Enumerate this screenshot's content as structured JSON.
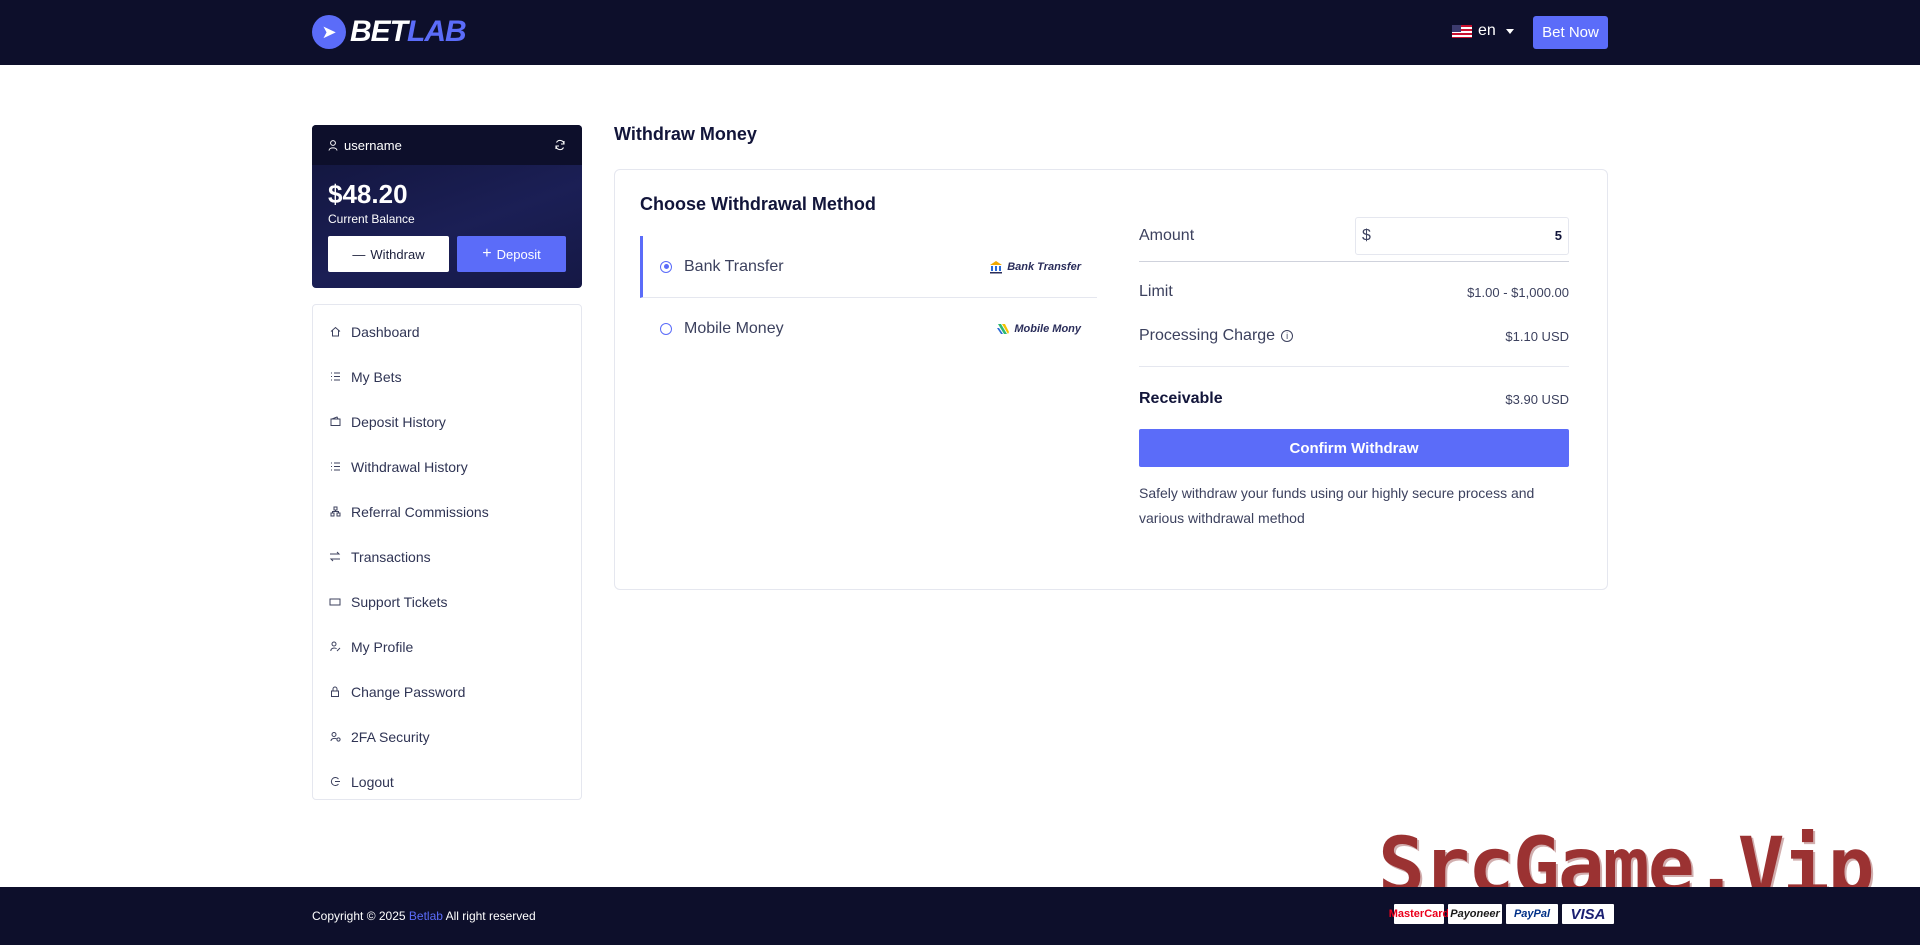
{
  "header": {
    "logo_bet": "BET",
    "logo_lab": "LAB",
    "language": "en",
    "bet_now": "Bet Now"
  },
  "balance": {
    "username": "username",
    "amount": "$48.20",
    "label": "Current Balance",
    "withdraw": "Withdraw",
    "deposit": "Deposit"
  },
  "menu": [
    {
      "label": "Dashboard",
      "icon": "home-icon"
    },
    {
      "label": "My Bets",
      "icon": "list-icon"
    },
    {
      "label": "Deposit History",
      "icon": "wallet-icon"
    },
    {
      "label": "Withdrawal History",
      "icon": "list-icon"
    },
    {
      "label": "Referral Commissions",
      "icon": "network-icon"
    },
    {
      "label": "Transactions",
      "icon": "exchange-icon"
    },
    {
      "label": "Support Tickets",
      "icon": "ticket-icon"
    },
    {
      "label": "My Profile",
      "icon": "user-edit-icon"
    },
    {
      "label": "Change Password",
      "icon": "lock-icon"
    },
    {
      "label": "2FA Security",
      "icon": "shield-user-icon"
    },
    {
      "label": "Logout",
      "icon": "logout-icon"
    }
  ],
  "main": {
    "title": "Withdraw Money",
    "choose_title": "Choose Withdrawal Method",
    "methods": [
      {
        "label": "Bank Transfer",
        "logo": "Bank Transfer",
        "selected": true
      },
      {
        "label": "Mobile Money",
        "logo": "Mobile Mony",
        "selected": false
      }
    ],
    "amount_label": "Amount",
    "currency_symbol": "$",
    "amount_value": "5",
    "limit_label": "Limit",
    "limit_value": "$1.00 - $1,000.00",
    "charge_label": "Processing Charge",
    "charge_value": "$1.10 USD",
    "receivable_label": "Receivable",
    "receivable_value": "$3.90 USD",
    "confirm": "Confirm Withdraw",
    "note": "Safely withdraw your funds using our highly secure process and various withdrawal method"
  },
  "footer": {
    "copyright_prefix": "Copyright © 2025",
    "brand": "Betlab",
    "copyright_suffix": "All right reserved",
    "payments": [
      "MasterCard",
      "Payoneer",
      "PayPal",
      "VISA"
    ]
  },
  "watermark": "SrcGame.Vip",
  "colors": {
    "navy": "#0d0f2b",
    "accent": "#5b6cf9",
    "border": "#e5e7ef"
  }
}
